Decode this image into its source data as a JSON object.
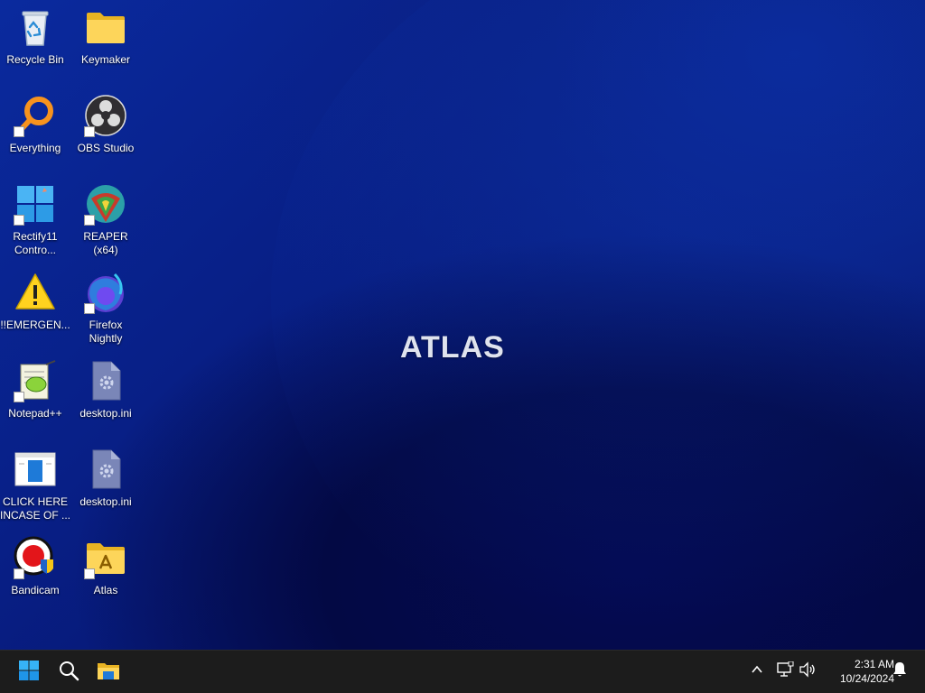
{
  "desktop": {
    "wallpaper_logo": "ATLAS",
    "icons": [
      {
        "label": "Recycle Bin",
        "icon": "recycle-bin-icon"
      },
      {
        "label": "Keymaker",
        "icon": "folder-icon"
      },
      {
        "label": "Everything",
        "icon": "everything-search-icon"
      },
      {
        "label": "OBS Studio",
        "icon": "obs-studio-icon"
      },
      {
        "label": "Rectify11\nContro...",
        "icon": "rectify11-control-panel-icon"
      },
      {
        "label": "REAPER (x64)",
        "icon": "reaper-icon"
      },
      {
        "label": "!!EMERGEN...",
        "icon": "warning-icon"
      },
      {
        "label": "Firefox\nNightly",
        "icon": "firefox-nightly-icon"
      },
      {
        "label": "Notepad++",
        "icon": "notepad-plus-plus-icon"
      },
      {
        "label": "desktop.ini",
        "icon": "settings-file-icon"
      },
      {
        "label": "CLICK HERE\nINCASE OF ...",
        "icon": "window-app-icon"
      },
      {
        "label": "desktop.ini",
        "icon": "settings-file-icon"
      },
      {
        "label": "Bandicam",
        "icon": "bandicam-icon"
      },
      {
        "label": "Atlas",
        "icon": "atlas-folder-icon"
      }
    ]
  },
  "taskbar": {
    "start_icon": "windows-start-icon",
    "search_icon": "search-icon",
    "explorer_icon": "file-explorer-icon",
    "tray": {
      "overflow_icon": "chevron-up-icon",
      "network_icon": "network-icon",
      "volume_icon": "volume-icon",
      "notification_icon": "bell-icon"
    },
    "clock": {
      "time": "2:31 AM",
      "date": "10/24/2024"
    }
  },
  "colors": {
    "taskbar_bg": "#1c1c1c",
    "wallpaper_primary": "#0a2389",
    "wallpaper_dark": "#030944"
  }
}
